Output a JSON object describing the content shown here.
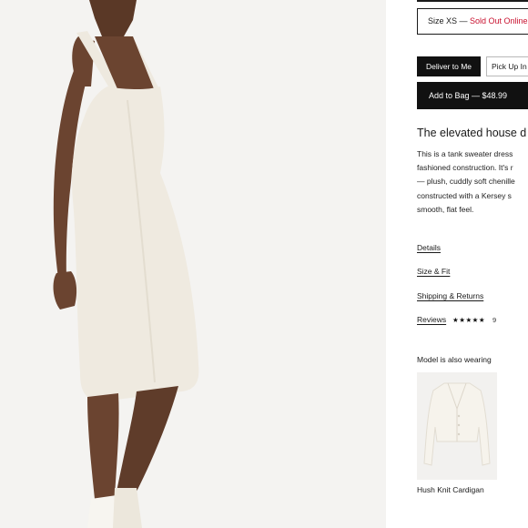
{
  "product": {
    "size_label": "Size XS — ",
    "size_status": "Sold Out Online",
    "size_status_color": "#c8102e",
    "deliver_label": "Deliver to Me",
    "pickup_label": "Pick Up In",
    "add_to_bag_label": "Add to Bag — $48.99",
    "headline": "The elevated house d",
    "description_lines": [
      "This is a tank sweater dress",
      "fashioned construction. It's r",
      "— plush, cuddly soft chenille",
      "constructed with a Kersey s",
      "smooth, flat feel."
    ],
    "links": {
      "details": "Details",
      "size_fit": "Size & Fit",
      "shipping": "Shipping & Returns",
      "reviews": "Reviews"
    },
    "rating_stars": "★★★★★",
    "review_count": "9",
    "also_wearing_heading": "Model is also wearing",
    "also_wearing_item": "Hush Knit Cardigan"
  },
  "icons": {
    "dress_photo": "model-photo",
    "cardigan_thumbnail": "cardigan-thumbnail"
  }
}
